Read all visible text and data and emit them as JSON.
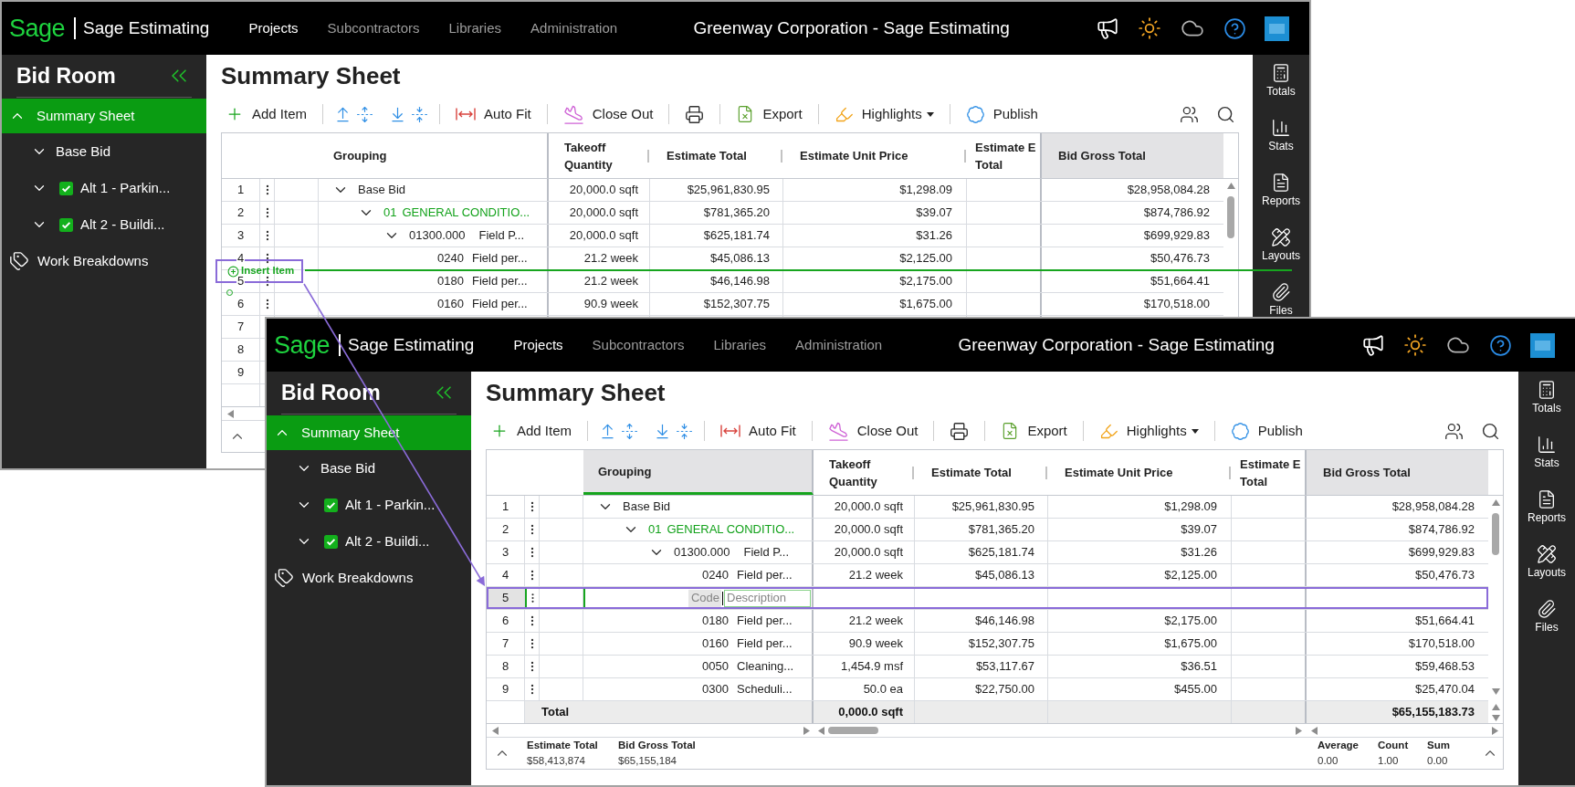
{
  "windows": [
    {
      "kind": "background",
      "app_bar": {
        "logo": "Sage",
        "product": "Sage Estimating",
        "nav": [
          {
            "label": "Projects",
            "selected": true
          },
          {
            "label": "Subcontractors",
            "selected": false
          },
          {
            "label": "Libraries",
            "selected": false
          },
          {
            "label": "Administration",
            "selected": false
          }
        ],
        "title": "Greenway Corporation - Sage Estimating"
      },
      "sidebar": {
        "title": "Bid Room",
        "items": [
          {
            "kind": "sheet",
            "label": "Summary Sheet",
            "selected": true,
            "expanded": true,
            "children": [
              {
                "kind": "bid",
                "label": "Base Bid",
                "selected": false,
                "expanded": false
              },
              {
                "kind": "alternate",
                "label": "Alt 1 - Parkin...",
                "selected": false,
                "expanded": false,
                "checked": true
              },
              {
                "kind": "alternate",
                "label": "Alt 2 - Buildi...",
                "selected": false,
                "expanded": false,
                "checked": true
              }
            ]
          },
          {
            "kind": "tag",
            "label": "Work Breakdowns",
            "selected": false
          }
        ]
      },
      "page_title": "Summary Sheet",
      "toolbar": {
        "groups": [
          [
            {
              "kind": "add",
              "label": "Add Item"
            }
          ],
          [
            {
              "kind": "move-up"
            },
            {
              "kind": "expand"
            },
            {
              "kind": "move-down"
            },
            {
              "kind": "collapse"
            }
          ],
          [
            {
              "kind": "auto-fit",
              "label": "Auto Fit"
            }
          ],
          [
            {
              "kind": "close-out",
              "label": "Close Out"
            }
          ],
          [
            {
              "kind": "print"
            }
          ],
          [
            {
              "kind": "export",
              "label": "Export"
            }
          ],
          [
            {
              "kind": "highlights",
              "label": "Highlights"
            }
          ],
          [
            {
              "kind": "publish",
              "label": "Publish"
            }
          ]
        ],
        "tools": [
          {
            "kind": "people"
          },
          {
            "kind": "search"
          }
        ]
      },
      "grid": {
        "columns": [
          {
            "label": "Grouping",
            "selected": false,
            "shaded": false
          },
          {
            "label": "Takeoff Quantity",
            "selected": false,
            "shaded": false
          },
          {
            "label": "Estimate Total",
            "selected": false,
            "shaded": false
          },
          {
            "label": "Estimate Unit Price",
            "selected": false,
            "shaded": false
          },
          {
            "label": "Estimate E Total",
            "selected": false,
            "shaded": false
          },
          {
            "label": "Bid Gross Total",
            "selected": false,
            "shaded": true
          }
        ],
        "rows": [
          {
            "number": "1",
            "kind": "bid",
            "description": "Base Bid",
            "expanded": true,
            "selected": false,
            "takeoff_quantity": "20,000.0 sqft",
            "estimate_total": "$25,961,830.95",
            "estimate_unit_price": "$1,298.09",
            "bid_gross_total": "$28,958,084.28",
            "children": [
              {
                "number": "2",
                "kind": "division",
                "code": "01",
                "description": "GENERAL CONDITIO...",
                "expanded": true,
                "selected": false,
                "takeoff_quantity": "20,000.0 sqft",
                "estimate_total": "$781,365.20",
                "estimate_unit_price": "$39.07",
                "bid_gross_total": "$874,786.92",
                "children": [
                  {
                    "number": "3",
                    "kind": "section",
                    "code": "01300.000",
                    "description": "Field P...",
                    "expanded": true,
                    "selected": false,
                    "takeoff_quantity": "20,000.0 sqft",
                    "estimate_total": "$625,181.74",
                    "estimate_unit_price": "$31.26",
                    "bid_gross_total": "$699,929.83",
                    "children": [
                      {
                        "number": "4",
                        "kind": "item",
                        "code": "0240",
                        "description": "Field per...",
                        "selected": false,
                        "takeoff_quantity": "21.2 week",
                        "estimate_total": "$45,086.13",
                        "estimate_unit_price": "$2,125.00",
                        "bid_gross_total": "$50,476.73"
                      },
                      {
                        "number": "5",
                        "kind": "item",
                        "code": "0180",
                        "description": "Field per...",
                        "selected": false,
                        "takeoff_quantity": "21.2 week",
                        "estimate_total": "$46,146.98",
                        "estimate_unit_price": "$2,175.00",
                        "bid_gross_total": "$51,664.41"
                      },
                      {
                        "number": "6",
                        "kind": "item",
                        "code": "0160",
                        "description": "Field per...",
                        "selected": false,
                        "takeoff_quantity": "90.9 week",
                        "estimate_total": "$152,307.75",
                        "estimate_unit_price": "$1,675.00",
                        "bid_gross_total": "$170,518.00"
                      },
                      {
                        "number": "7",
                        "kind": "covered",
                        "selected": false
                      },
                      {
                        "number": "8",
                        "kind": "covered",
                        "selected": false
                      },
                      {
                        "number": "9",
                        "kind": "covered",
                        "selected": false
                      }
                    ]
                  }
                ]
              }
            ]
          }
        ]
      },
      "insert_indicator": {
        "label": "Insert Item"
      },
      "rail": [
        {
          "kind": "totals",
          "label": "Totals"
        },
        {
          "kind": "stats",
          "label": "Stats"
        },
        {
          "kind": "reports",
          "label": "Reports"
        },
        {
          "kind": "layouts",
          "label": "Layouts"
        },
        {
          "kind": "files",
          "label": "Files"
        }
      ]
    },
    {
      "kind": "foreground",
      "app_bar": {
        "logo": "Sage",
        "product": "Sage Estimating",
        "nav": [
          {
            "label": "Projects",
            "selected": true
          },
          {
            "label": "Subcontractors",
            "selected": false
          },
          {
            "label": "Libraries",
            "selected": false
          },
          {
            "label": "Administration",
            "selected": false
          }
        ],
        "title": "Greenway Corporation - Sage Estimating"
      },
      "sidebar": {
        "title": "Bid Room",
        "items": [
          {
            "kind": "sheet",
            "label": "Summary Sheet",
            "selected": true,
            "expanded": true,
            "children": [
              {
                "kind": "bid",
                "label": "Base Bid",
                "selected": false,
                "expanded": false
              },
              {
                "kind": "alternate",
                "label": "Alt 1 - Parkin...",
                "selected": false,
                "expanded": false,
                "checked": true
              },
              {
                "kind": "alternate",
                "label": "Alt 2 - Buildi...",
                "selected": false,
                "expanded": false,
                "checked": true
              }
            ]
          },
          {
            "kind": "tag",
            "label": "Work Breakdowns",
            "selected": false
          }
        ]
      },
      "page_title": "Summary Sheet",
      "toolbar": {
        "groups": [
          [
            {
              "kind": "add",
              "label": "Add Item"
            }
          ],
          [
            {
              "kind": "move-up"
            },
            {
              "kind": "expand"
            },
            {
              "kind": "move-down"
            },
            {
              "kind": "collapse"
            }
          ],
          [
            {
              "kind": "auto-fit",
              "label": "Auto Fit"
            }
          ],
          [
            {
              "kind": "close-out",
              "label": "Close Out"
            }
          ],
          [
            {
              "kind": "print"
            }
          ],
          [
            {
              "kind": "export",
              "label": "Export"
            }
          ],
          [
            {
              "kind": "highlights",
              "label": "Highlights"
            }
          ],
          [
            {
              "kind": "publish",
              "label": "Publish"
            }
          ]
        ],
        "tools": [
          {
            "kind": "people"
          },
          {
            "kind": "search"
          }
        ]
      },
      "grid": {
        "columns": [
          {
            "label": "Grouping",
            "selected": true,
            "shaded": true
          },
          {
            "label": "Takeoff Quantity",
            "selected": false,
            "shaded": false
          },
          {
            "label": "Estimate Total",
            "selected": false,
            "shaded": false
          },
          {
            "label": "Estimate Unit Price",
            "selected": false,
            "shaded": false
          },
          {
            "label": "Estimate E Total",
            "selected": false,
            "shaded": false
          },
          {
            "label": "Bid Gross Total",
            "selected": false,
            "shaded": true
          }
        ],
        "rows": [
          {
            "number": "1",
            "kind": "bid",
            "description": "Base Bid",
            "expanded": true,
            "selected": false,
            "takeoff_quantity": "20,000.0 sqft",
            "estimate_total": "$25,961,830.95",
            "estimate_unit_price": "$1,298.09",
            "bid_gross_total": "$28,958,084.28",
            "children": [
              {
                "number": "2",
                "kind": "division",
                "code": "01",
                "description": "GENERAL CONDITIO...",
                "expanded": true,
                "selected": false,
                "takeoff_quantity": "20,000.0 sqft",
                "estimate_total": "$781,365.20",
                "estimate_unit_price": "$39.07",
                "bid_gross_total": "$874,786.92",
                "children": [
                  {
                    "number": "3",
                    "kind": "section",
                    "code": "01300.000",
                    "description": "Field P...",
                    "expanded": true,
                    "selected": false,
                    "takeoff_quantity": "20,000.0 sqft",
                    "estimate_total": "$625,181.74",
                    "estimate_unit_price": "$31.26",
                    "bid_gross_total": "$699,929.83",
                    "children": [
                      {
                        "number": "4",
                        "kind": "item",
                        "code": "0240",
                        "description": "Field per...",
                        "selected": false,
                        "takeoff_quantity": "21.2 week",
                        "estimate_total": "$45,086.13",
                        "estimate_unit_price": "$2,125.00",
                        "bid_gross_total": "$50,476.73"
                      },
                      {
                        "number": "5",
                        "kind": "new",
                        "code": {
                          "placeholder": "Code"
                        },
                        "description": {
                          "placeholder": "Description"
                        },
                        "selected": true
                      },
                      {
                        "number": "6",
                        "kind": "item",
                        "code": "0180",
                        "description": "Field per...",
                        "selected": false,
                        "takeoff_quantity": "21.2 week",
                        "estimate_total": "$46,146.98",
                        "estimate_unit_price": "$2,175.00",
                        "bid_gross_total": "$51,664.41"
                      },
                      {
                        "number": "7",
                        "kind": "item",
                        "code": "0160",
                        "description": "Field per...",
                        "selected": false,
                        "takeoff_quantity": "90.9 week",
                        "estimate_total": "$152,307.75",
                        "estimate_unit_price": "$1,675.00",
                        "bid_gross_total": "$170,518.00"
                      },
                      {
                        "number": "8",
                        "kind": "item",
                        "code": "0050",
                        "description": "Cleaning...",
                        "selected": false,
                        "takeoff_quantity": "1,454.9 msf",
                        "estimate_total": "$53,117.67",
                        "estimate_unit_price": "$36.51",
                        "bid_gross_total": "$59,468.53"
                      },
                      {
                        "number": "9",
                        "kind": "item",
                        "code": "0300",
                        "description": "Scheduli...",
                        "selected": false,
                        "takeoff_quantity": "50.0 ea",
                        "estimate_total": "$22,750.00",
                        "estimate_unit_price": "$455.00",
                        "bid_gross_total": "$25,470.04"
                      }
                    ]
                  }
                ]
              }
            ]
          }
        ],
        "total": {
          "label": "Total",
          "takeoff_quantity": "0,000.0 sqft",
          "bid_gross_total": "$65,155,183.73"
        },
        "footer": {
          "totals": [
            {
              "label": "Estimate Total",
              "value": "$58,413,874"
            },
            {
              "label": "Bid Gross Total",
              "value": "$65,155,184"
            }
          ],
          "stats": [
            {
              "label": "Average",
              "value": "0.00"
            },
            {
              "label": "Count",
              "value": "1.00"
            },
            {
              "label": "Sum",
              "value": "0.00"
            }
          ]
        }
      },
      "rail": [
        {
          "kind": "totals",
          "label": "Totals"
        },
        {
          "kind": "stats",
          "label": "Stats"
        },
        {
          "kind": "reports",
          "label": "Reports"
        },
        {
          "kind": "layouts",
          "label": "Layouts"
        },
        {
          "kind": "files",
          "label": "Files"
        }
      ]
    }
  ]
}
